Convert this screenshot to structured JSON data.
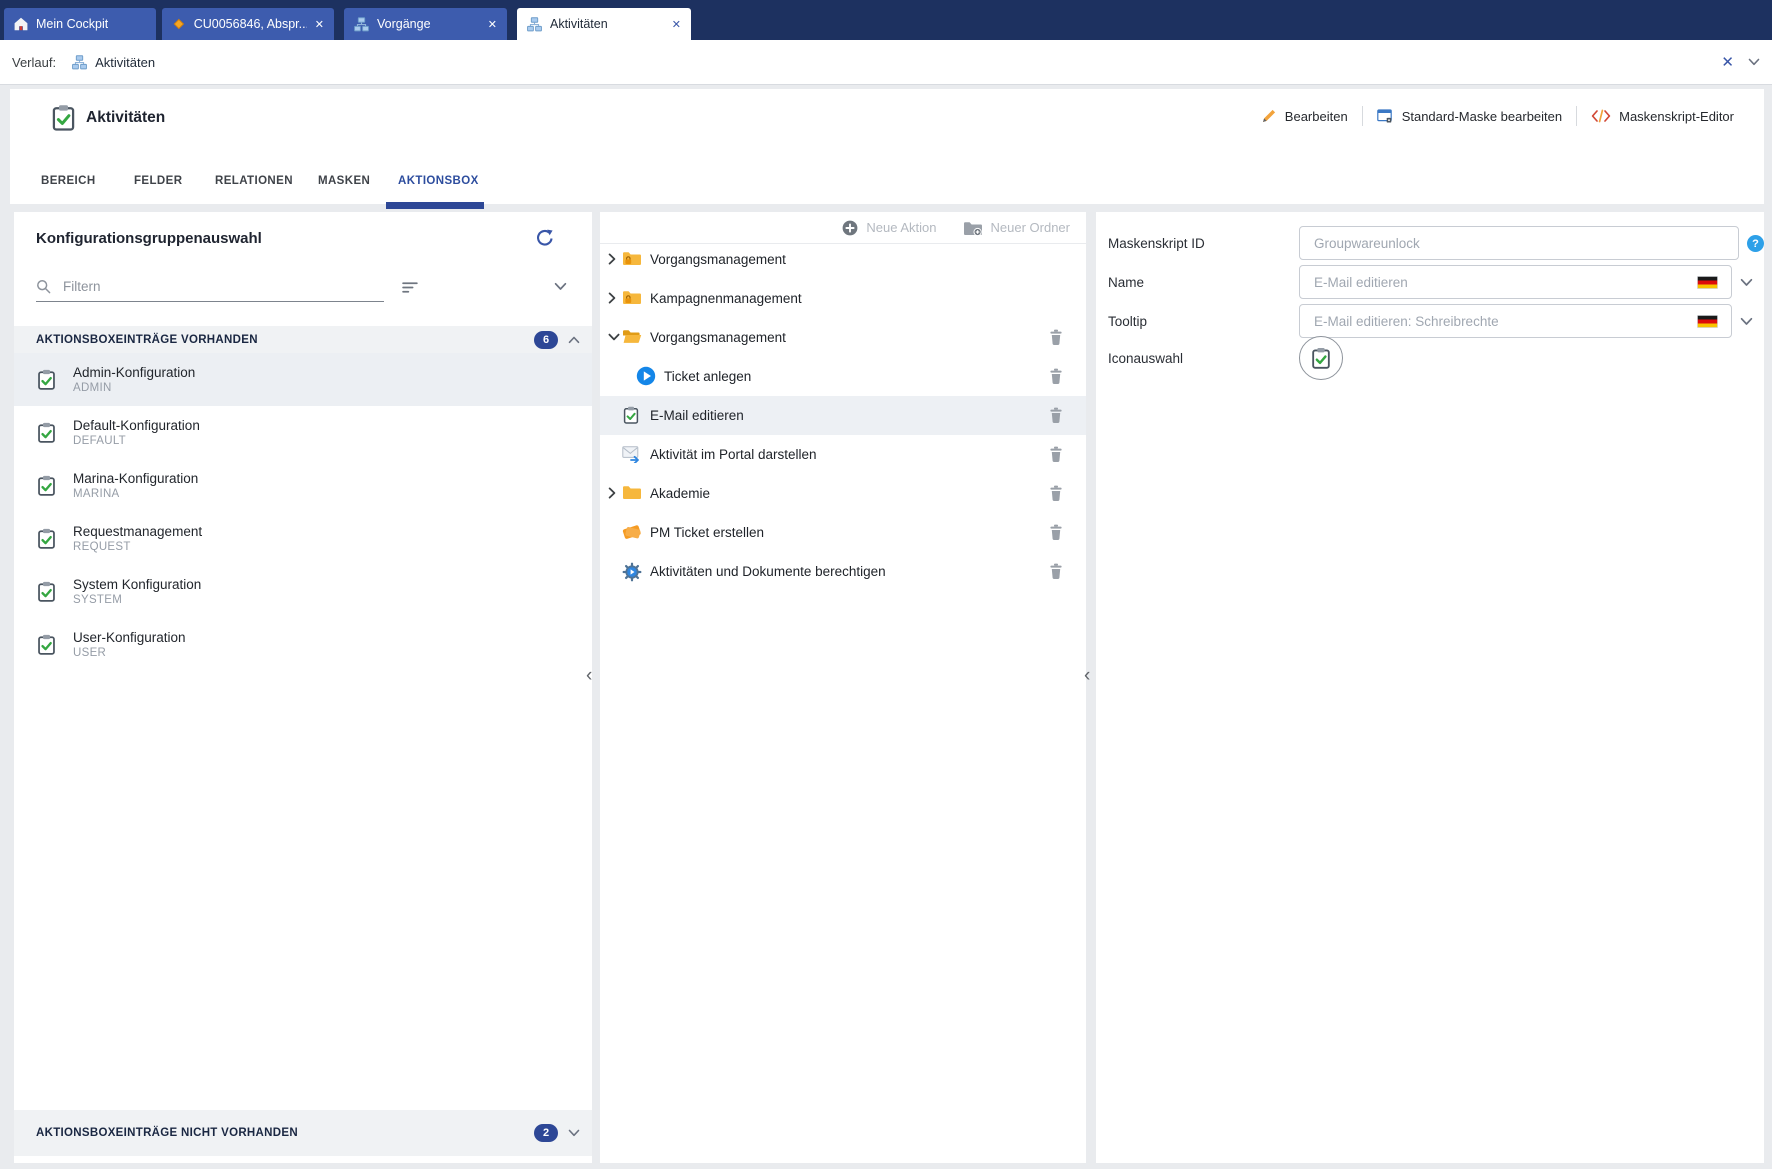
{
  "topbar": {
    "tabs": [
      {
        "label": "Mein Cockpit"
      },
      {
        "label": "CU0056846, Abspr..."
      },
      {
        "label": "Vorgänge"
      },
      {
        "label": "Aktivitäten"
      }
    ]
  },
  "verlauf": {
    "label": "Verlauf:",
    "item": "Aktivitäten"
  },
  "header": {
    "title": "Aktivitäten",
    "actions": {
      "edit": "Bearbeiten",
      "standard_mask": "Standard-Maske bearbeiten",
      "mask_script": "Maskenskript-Editor"
    }
  },
  "tabstrip": {
    "tabs": [
      "BEREICH",
      "FELDER",
      "RELATIONEN",
      "MASKEN",
      "AKTIONSBOX"
    ],
    "active": "AKTIONSBOX"
  },
  "config_panel": {
    "title": "Konfigurationsgruppenauswahl",
    "filter_placeholder": "Filtern",
    "sections": {
      "available": {
        "label": "AKTIONSBOXEINTRÄGE VORHANDEN",
        "count": "6"
      },
      "missing": {
        "label": "AKTIONSBOXEINTRÄGE NICHT VORHANDEN",
        "count": "2"
      }
    },
    "items": [
      {
        "title": "Admin-Konfiguration",
        "code": "ADMIN"
      },
      {
        "title": "Default-Konfiguration",
        "code": "DEFAULT"
      },
      {
        "title": "Marina-Konfiguration",
        "code": "MARINA"
      },
      {
        "title": "Requestmanagement",
        "code": "REQUEST"
      },
      {
        "title": "System Konfiguration",
        "code": "SYSTEM"
      },
      {
        "title": "User-Konfiguration",
        "code": "USER"
      }
    ]
  },
  "tree_panel": {
    "toolbar": {
      "new_action": "Neue Aktion",
      "new_folder": "Neuer Ordner"
    },
    "nodes": [
      {
        "label": "Vorgangsmanagement"
      },
      {
        "label": "Kampagnenmanagement"
      },
      {
        "label": "Vorgangsmanagement"
      },
      {
        "label": "Ticket anlegen"
      },
      {
        "label": "E-Mail editieren"
      },
      {
        "label": "Aktivität im Portal darstellen"
      },
      {
        "label": "Akademie"
      },
      {
        "label": "PM Ticket erstellen"
      },
      {
        "label": "Aktivitäten und Dokumente berechtigen"
      }
    ]
  },
  "form_panel": {
    "mask_script_id": {
      "label": "Maskenskript ID",
      "value": "Groupwareunlock"
    },
    "name": {
      "label": "Name",
      "value": "E-Mail editieren"
    },
    "tooltip": {
      "label": "Tooltip",
      "value": "E-Mail editieren: Schreibrechte"
    },
    "icon_select": {
      "label": "Iconauswahl"
    },
    "help_glyph": "?"
  },
  "colors": {
    "accent": "#2d4796",
    "topbar_bg": "#1d3160",
    "tab_bg": "#3d5cae",
    "selection_bg": "#edf0f4",
    "badge_bg": "#2d4796",
    "success_green": "#35a742",
    "folder_orange": "#f6b73c"
  }
}
